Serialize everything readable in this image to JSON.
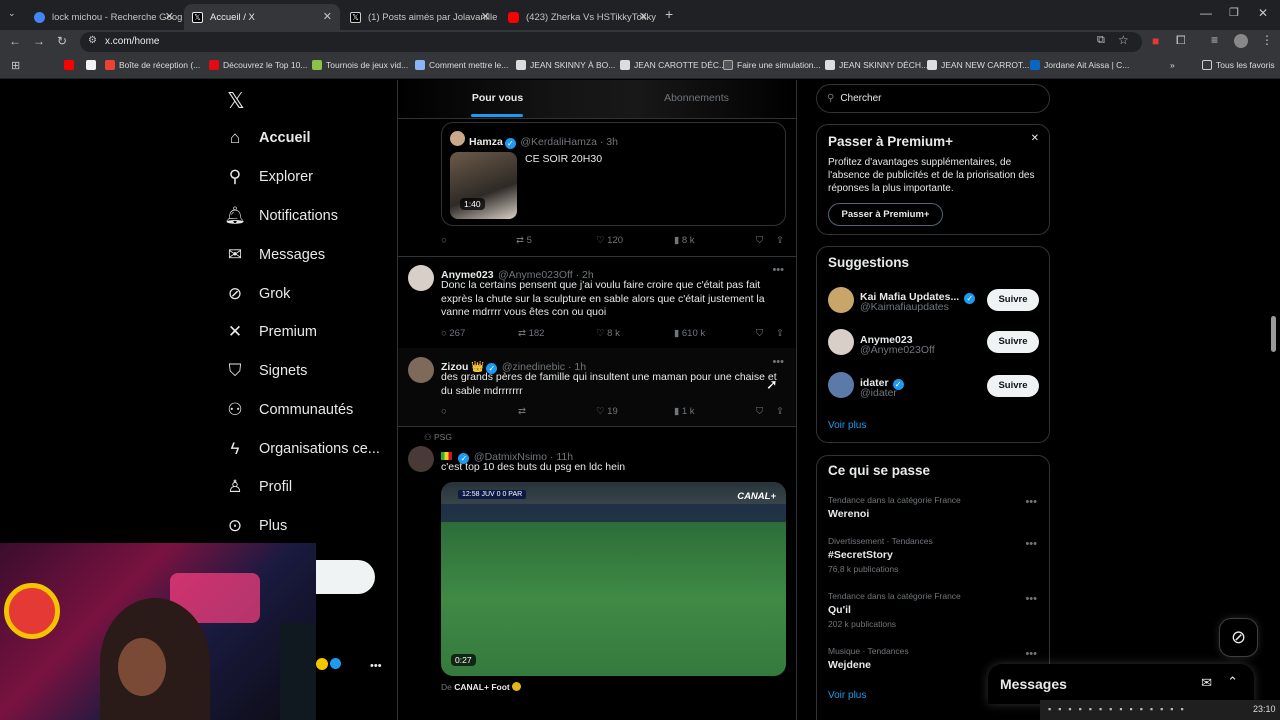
{
  "browser": {
    "tabs": [
      {
        "title": "lock michou - Recherche Googl",
        "color": "#4285f4"
      },
      {
        "title": "Accueil / X",
        "color": "#e8eaed"
      },
      {
        "title": "(1) Posts aimés par Jolavanille 🍦",
        "color": "#e8eaed"
      },
      {
        "title": "(423) Zherka Vs HSTikkyTokky (",
        "color": "#ff0000"
      }
    ],
    "url": "x.com/home",
    "bookmarks": [
      "Boîte de réception (...",
      "Découvrez le Top 10...",
      "Tournois de jeux vid...",
      "Comment mettre le...",
      "JEAN SKINNY À BO...",
      "JEAN CAROTTE DÉC...",
      "Faire une simulation...",
      "JEAN SKINNY DÉCH...",
      "JEAN NEW CARROT...",
      "Jordane Ait Aissa | C..."
    ],
    "all_bookmarks": "Tous les favoris"
  },
  "nav": {
    "items": [
      {
        "label": "Accueil",
        "icon": "home-icon"
      },
      {
        "label": "Explorer",
        "icon": "search-icon"
      },
      {
        "label": "Notifications",
        "icon": "bell-icon"
      },
      {
        "label": "Messages",
        "icon": "mail-icon"
      },
      {
        "label": "Grok",
        "icon": "grok-icon"
      },
      {
        "label": "Premium",
        "icon": "x-logo-icon"
      },
      {
        "label": "Signets",
        "icon": "bookmark-icon"
      },
      {
        "label": "Communautés",
        "icon": "people-icon"
      },
      {
        "label": "Organisations ce...",
        "icon": "lightning-icon"
      },
      {
        "label": "Profil",
        "icon": "person-icon"
      },
      {
        "label": "Plus",
        "icon": "more-circle-icon"
      }
    ]
  },
  "feed": {
    "tabs": [
      "Pour vous",
      "Abonnements"
    ],
    "quote": {
      "name": "Hamza",
      "handle": "@KerdaliHamza · 3h",
      "text": "CE SOIR 20H30",
      "duration": "1:40",
      "actions": {
        "retweets": "5",
        "likes": "120",
        "views": "8 k"
      }
    },
    "posts": [
      {
        "name": "Anyme023",
        "handle": "@Anyme023Off · 2h",
        "text": "Donc la certains pensent que j'ai voulu faire croire que c'était pas fait exprès la chute sur la sculpture en sable alors que c'était justement la vanne mdrrrr vous êtes con ou quoi",
        "replies": "267",
        "retweets": "182",
        "likes": "8 k",
        "views": "610 k"
      },
      {
        "name": "Zizou 👑",
        "handle": "@zinedinebic · 1h",
        "text": "des grands pères de famille qui insultent une maman pour une chaise et du sable mdrrrrrrr",
        "replies": "",
        "retweets": "",
        "likes": "19",
        "views": "1 k"
      }
    ],
    "psg_post": {
      "context": "PSG",
      "handle": "@DatmixNsimo · 11h",
      "text": "c'est top 10 des buts du psg en ldc hein",
      "video_duration": "0:27",
      "source_prefix": "De",
      "source": "CANAL+ Foot",
      "broadcaster": "CANAL+",
      "scoreboard": "12:58  JUV 0 0 PAR"
    }
  },
  "sidebar": {
    "search_placeholder": "Chercher",
    "premium": {
      "title": "Passer à Premium+",
      "text": "Profitez d'avantages supplémentaires, de l'absence de publicités et de la priorisation des réponses la plus importante.",
      "button": "Passer à Premium+"
    },
    "suggestions": {
      "title": "Suggestions",
      "items": [
        {
          "name": "Kai Mafia Updates...",
          "handle": "@Kaimafiaupdates",
          "button": "Suivre"
        },
        {
          "name": "Anyme023",
          "handle": "@Anyme023Off",
          "button": "Suivre"
        },
        {
          "name": "idater",
          "handle": "@idater",
          "button": "Suivre"
        }
      ],
      "more": "Voir plus"
    },
    "trends": {
      "title": "Ce qui se passe",
      "items": [
        {
          "meta": "Tendance dans la catégorie France",
          "name": "Werenoi",
          "count": ""
        },
        {
          "meta": "Divertissement · Tendances",
          "name": "#SecretStory",
          "count": "76,8 k publications"
        },
        {
          "meta": "Tendance dans la catégorie France",
          "name": "Qu'il",
          "count": "202 k publications"
        },
        {
          "meta": "Musique · Tendances",
          "name": "Wejdene",
          "count": ""
        }
      ],
      "more": "Voir plus"
    }
  },
  "messages_drawer": {
    "title": "Messages"
  },
  "taskbar": {
    "time": "23:10"
  },
  "colors": {
    "accent": "#1d9bf0",
    "background": "#000000",
    "border": "#2f3336",
    "muted": "#71767b"
  }
}
